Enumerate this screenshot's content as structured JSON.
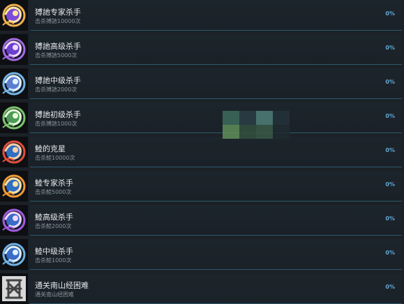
{
  "achievements": [
    {
      "title": "猼訑专家杀手",
      "desc": "击杀猼訑10000次",
      "percent": "0%",
      "icon": "purple-swirl-creature-icon",
      "colors": {
        "ring": "#f1b24a",
        "core": "#ffe7a3",
        "body": "#7c4bd8"
      }
    },
    {
      "title": "猼訑高级杀手",
      "desc": "击杀猼訑5000次",
      "percent": "0%",
      "icon": "violet-swirl-creature-icon",
      "colors": {
        "ring": "#a56be6",
        "core": "#f0dcff",
        "body": "#6b3fd0"
      }
    },
    {
      "title": "猼訑中级杀手",
      "desc": "击杀猼訑2000次",
      "percent": "0%",
      "icon": "blue-swirl-creature-icon",
      "colors": {
        "ring": "#74b6e8",
        "core": "#e6f4ff",
        "body": "#5d7fd2"
      }
    },
    {
      "title": "猼訑初级杀手",
      "desc": "击杀猼訑1000次",
      "percent": "0%",
      "icon": "green-swirl-creature-icon",
      "colors": {
        "ring": "#7cc56b",
        "core": "#e7ffd9",
        "body": "#4e9a58"
      }
    },
    {
      "title": "鯥的克星",
      "desc": "击杀鯥10000次",
      "percent": "0%",
      "icon": "red-fish-creature-icon",
      "colors": {
        "ring": "#e24f3b",
        "core": "#ffd0a8",
        "body": "#2f6fc4"
      }
    },
    {
      "title": "鯥专家杀手",
      "desc": "击杀鯥5000次",
      "percent": "0%",
      "icon": "orange-fish-creature-icon",
      "colors": {
        "ring": "#f19a34",
        "core": "#ffe3a3",
        "body": "#2f6fc4"
      }
    },
    {
      "title": "鯥高级杀手",
      "desc": "击杀鯥2000次",
      "percent": "0%",
      "icon": "purple-fish-creature-icon",
      "colors": {
        "ring": "#a35be2",
        "core": "#f2d9ff",
        "body": "#3a6cc8"
      }
    },
    {
      "title": "鯥中级杀手",
      "desc": "击杀鯥1000次",
      "percent": "0%",
      "icon": "blue-fish-creature-icon",
      "colors": {
        "ring": "#6fb3e8",
        "core": "#e0f2ff",
        "body": "#3a6cc8"
      }
    },
    {
      "title": "通关南山经困难",
      "desc": "通关南山经困难",
      "percent": "0%",
      "icon": "calligraphy-seal-icon",
      "colors": {
        "ring": "#b9b9b9",
        "core": "#e8e8e8",
        "body": "#444444"
      }
    }
  ],
  "mosaic_colors": [
    "#3d6b5c",
    "#2b3d46",
    "#4f7f78",
    "#243139",
    "#5f8f5a",
    "#33503e",
    "#3a5947",
    "#1f2a31"
  ]
}
